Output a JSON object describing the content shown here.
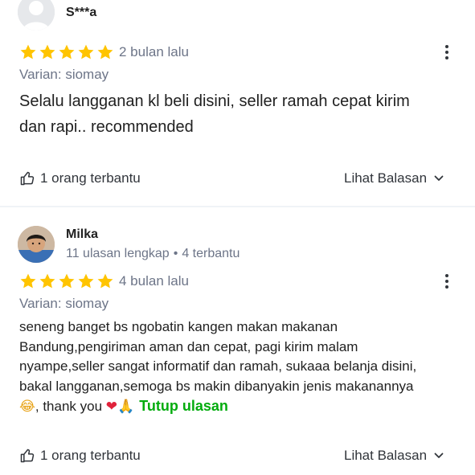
{
  "reviews": [
    {
      "user_name": "S***a",
      "rating": 5,
      "time_ago": "2 bulan lalu",
      "variant": "Varian: siomay",
      "text_lines": [
        "Selalu langganan kl beli disini, seller ramah cepat kirim",
        "dan rapi.. recommended"
      ],
      "helpful_text": "1 orang terbantu",
      "replies_label": "Lihat Balasan"
    },
    {
      "user_name": "Milka",
      "meta_reviews": "11 ulasan lengkap",
      "meta_separator": "•",
      "meta_helpful": "4 terbantu",
      "rating": 5,
      "time_ago": "4 bulan lalu",
      "variant": "Varian: siomay",
      "text_lines": [
        "seneng banget bs ngobatin kangen makan makanan",
        "Bandung,pengiriman aman dan cepat, pagi kirim malam",
        "nyampe,seller sangat informatif dan ramah, sukaaa belanja disini,",
        "bakal langganan,semoga bs makin dibanyakin jenis makanannya"
      ],
      "text_last_line": ", thank you",
      "emoji_laugh": "😂",
      "emoji_heart": "❤",
      "emoji_pray": "🙏",
      "collapse_label": "Tutup ulasan",
      "helpful_text": "1 orang terbantu",
      "replies_label": "Lihat Balasan"
    }
  ],
  "colors": {
    "star": "#ffc400",
    "accent_green": "#03ac0e",
    "muted_text": "#6d7588"
  },
  "icons": [
    "user-avatar-placeholder",
    "star-icon",
    "kebab-menu-icon",
    "thumbs-up-icon",
    "chevron-down-icon"
  ]
}
